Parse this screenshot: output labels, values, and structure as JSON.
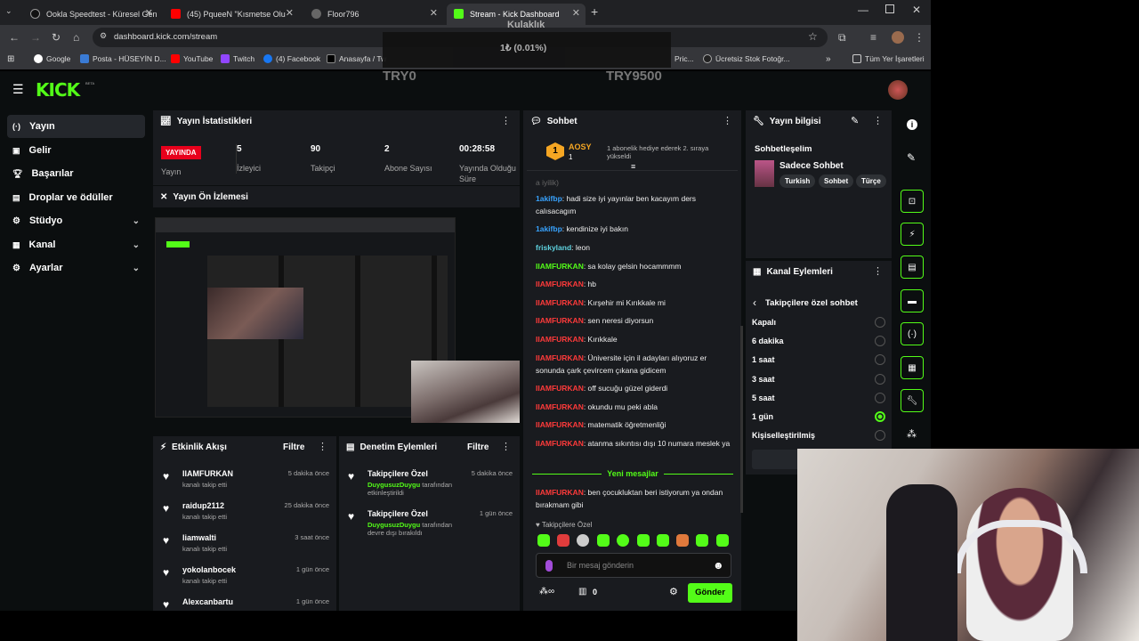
{
  "tabs": [
    {
      "title": "Ookla Speedtest - Küresel Gen"
    },
    {
      "title": "(45) PqueeN \"Kısmetse Olu"
    },
    {
      "title": "Floor796"
    },
    {
      "title": "Stream - Kick Dashboard"
    }
  ],
  "address": "dashboard.kick.com/stream",
  "bookmarks": [
    "Google",
    "Posta - HÜSEYİN D...",
    "YouTube",
    "Twitch",
    "(4) Facebook",
    "Anasayfa / Tw",
    "Pric...",
    "Ücretsiz Stok Fotoğr...",
    "Tüm Yer İşaretleri"
  ],
  "overlay": {
    "title": "Kulaklık",
    "value": "1₺ (0.01%)",
    "left": "TRY0",
    "right": "TRY9500"
  },
  "brand": {
    "logo": "KICK",
    "beta": "BETA"
  },
  "sidebar": {
    "items": [
      {
        "label": "Yayın",
        "icon": "broadcast-icon"
      },
      {
        "label": "Gelir",
        "icon": "wallet-icon"
      },
      {
        "label": "Başarılar",
        "icon": "trophy-icon"
      },
      {
        "label": "Droplar ve ödüller",
        "icon": "gift-icon"
      },
      {
        "label": "Stüdyo",
        "icon": "gear-icon"
      },
      {
        "label": "Kanal",
        "icon": "channel-icon"
      },
      {
        "label": "Ayarlar",
        "icon": "settings-icon"
      }
    ]
  },
  "stats": {
    "title": "Yayın İstatistikleri",
    "live_badge": "YAYINDA",
    "live_label": "Yayın",
    "items": [
      {
        "value": "5",
        "label": "İzleyici"
      },
      {
        "value": "90",
        "label": "Takipçi"
      },
      {
        "value": "2",
        "label": "Abone Sayısı"
      },
      {
        "value": "00:28:58",
        "label": "Yayında Olduğu Süre"
      }
    ]
  },
  "preview": {
    "title": "Yayın Ön İzlemesi"
  },
  "activity": {
    "title": "Etkinlik Akışı",
    "filter": "Filtre",
    "items": [
      {
        "user": "IIAMFURKAN",
        "sub": "kanalı takip etti",
        "time": "5 dakika önce"
      },
      {
        "user": "raidup2112",
        "sub": "kanalı takip etti",
        "time": "25 dakika önce"
      },
      {
        "user": "liamwalti",
        "sub": "kanalı takip etti",
        "time": "3 saat önce"
      },
      {
        "user": "yokolanbocek",
        "sub": "kanalı takip etti",
        "time": "1 gün önce"
      },
      {
        "user": "Alexcanbartu",
        "sub": "",
        "time": "1 gün önce"
      }
    ]
  },
  "moderation": {
    "title": "Denetim Eylemleri",
    "filter": "Filtre",
    "items": [
      {
        "title": "Takipçilere Özel",
        "user": "DuygusuzDuygu",
        "rest": " tarafından etkinleştirildi",
        "time": "5 dakika önce"
      },
      {
        "title": "Takipçilere Özel",
        "user": "DuygusuzDuygu",
        "rest": " tarafından devre dışı bırakıldı",
        "time": "1 gün önce"
      }
    ]
  },
  "chat": {
    "title": "Sohbet",
    "pinned_user": "AOSY",
    "pinned_count": "1",
    "pinned_text": "1 abonelik hediye ederek 2. sıraya yükseldi",
    "cut_text": "a iyilik)",
    "messages": [
      {
        "user": "1akifbp",
        "color": "blue",
        "text": ": hadi size iyi yayınlar ben kacayım ders calısacagım"
      },
      {
        "user": "1akifbp",
        "color": "blue",
        "text": ": kendinize iyi bakın"
      },
      {
        "user": "friskyland",
        "color": "teal",
        "text": ": leon"
      },
      {
        "user": "IIAMFURKAN",
        "color": "green",
        "text": ": sa kolay gelsin hocammmm"
      },
      {
        "user": "IIAMFURKAN",
        "color": "red",
        "text": ": hb"
      },
      {
        "user": "IIAMFURKAN",
        "color": "red",
        "text": ": Kırşehir mi Kırıkkale mi"
      },
      {
        "user": "IIAMFURKAN",
        "color": "red",
        "text": ": sen neresi diyorsun"
      },
      {
        "user": "IIAMFURKAN",
        "color": "red",
        "text": ": Kırıkkale"
      },
      {
        "user": "IIAMFURKAN",
        "color": "red",
        "text": ": Üniversite için il adayları alıyoruz er sonunda çark çevircem çıkana gidicem"
      },
      {
        "user": "IIAMFURKAN",
        "color": "red",
        "text": ": off sucuğu güzel giderdi"
      },
      {
        "user": "IIAMFURKAN",
        "color": "red",
        "text": ": okundu mu peki abla"
      },
      {
        "user": "IIAMFURKAN",
        "color": "red",
        "text": ": matematik öğretmenliği"
      },
      {
        "user": "IIAMFURKAN",
        "color": "red",
        "text": ": atanma sıkıntısı dışı 10 numara meslek ya"
      }
    ],
    "new_divider": "Yeni mesajlar",
    "last": {
      "user": "IIAMFURKAN",
      "text": ": ben çocukluktan beri istiyorum ya ondan bırakmam gibi"
    },
    "followers_only": "Takipçilere Özel",
    "input_placeholder": "Bir mesaj gönderin",
    "count_a": "0",
    "send": "Gönder"
  },
  "stream_info": {
    "title": "Yayın bilgisi",
    "heading": "Sohbetleşelim",
    "category": "Sadece Sohbet",
    "tags": [
      "Turkish",
      "Sohbet",
      "Türçe"
    ]
  },
  "channel_actions": {
    "title": "Kanal Eylemleri",
    "sub": "Takipçilere özel sohbet",
    "options": [
      {
        "label": "Kapalı",
        "on": false
      },
      {
        "label": "6 dakika",
        "on": false
      },
      {
        "label": "1 saat",
        "on": false
      },
      {
        "label": "3 saat",
        "on": false
      },
      {
        "label": "5 saat",
        "on": false
      },
      {
        "label": "1 gün",
        "on": true
      },
      {
        "label": "Kişiselleştirilmiş",
        "on": false
      }
    ]
  },
  "colors": {
    "accent": "#53fc18",
    "live": "#e8001c",
    "bg": "#0b0e0f",
    "panel": "#191b1f"
  }
}
